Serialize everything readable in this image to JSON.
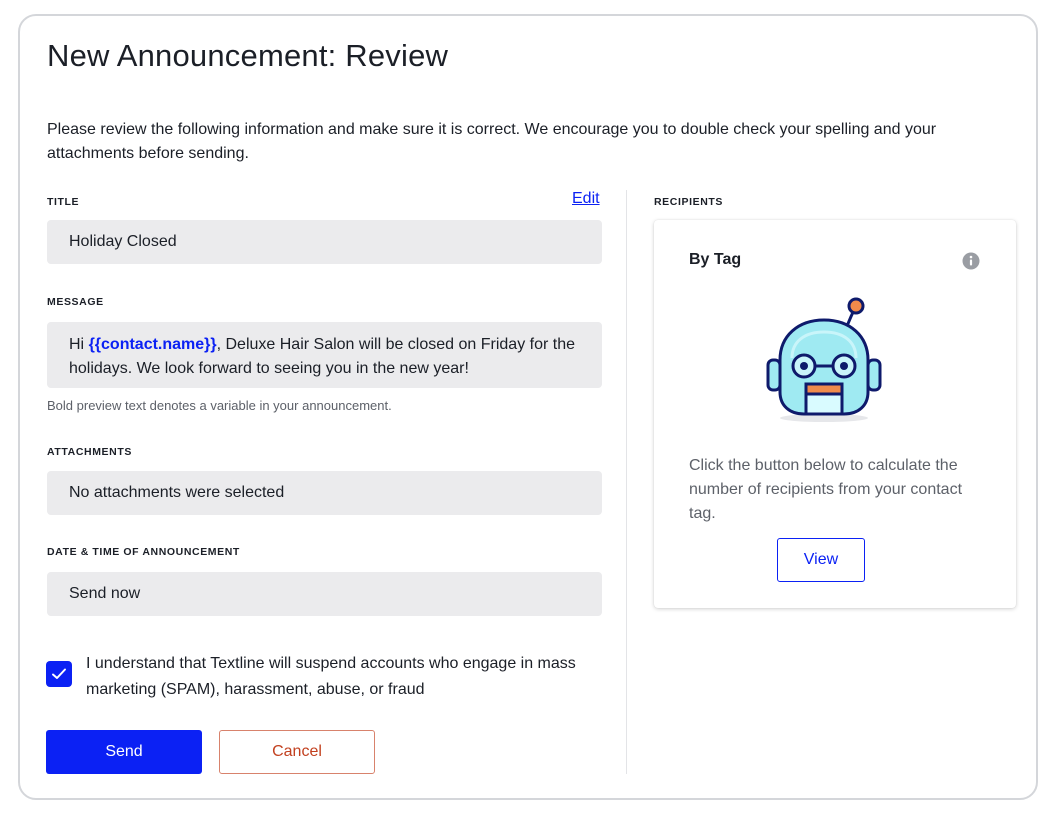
{
  "page_title": "New Announcement: Review",
  "intro": "Please review the following information and make sure it is correct. We encourage you to double check your spelling and your attachments before sending.",
  "title_section": {
    "label": "TITLE",
    "edit": "Edit",
    "value": "Holiday Closed"
  },
  "message_section": {
    "label": "MESSAGE",
    "greeting": "Hi ",
    "variable": "{{contact.name}}",
    "body": ", Deluxe Hair Salon will be closed on Friday for the holidays. We look forward to seeing you in the new year!",
    "hint": "Bold preview text denotes a variable in your announcement."
  },
  "attachments_section": {
    "label": "ATTACHMENTS",
    "value": "No attachments were selected"
  },
  "datetime_section": {
    "label": "DATE & TIME OF ANNOUNCEMENT",
    "value": "Send now"
  },
  "consent": {
    "checked": true,
    "text": "I understand that Textline will suspend accounts who engage in mass marketing (SPAM), harassment, abuse, or fraud"
  },
  "actions": {
    "send": "Send",
    "cancel": "Cancel"
  },
  "recipients": {
    "label": "RECIPIENTS",
    "card_title": "By Tag",
    "info_icon": "info-icon",
    "illustration": "robot-illustration",
    "description": "Click the button below to calculate the number of recipients from your contact tag.",
    "view": "View"
  },
  "colors": {
    "accent": "#0b21f4",
    "cancel": "#c2401f",
    "field_bg": "#ebebed"
  }
}
